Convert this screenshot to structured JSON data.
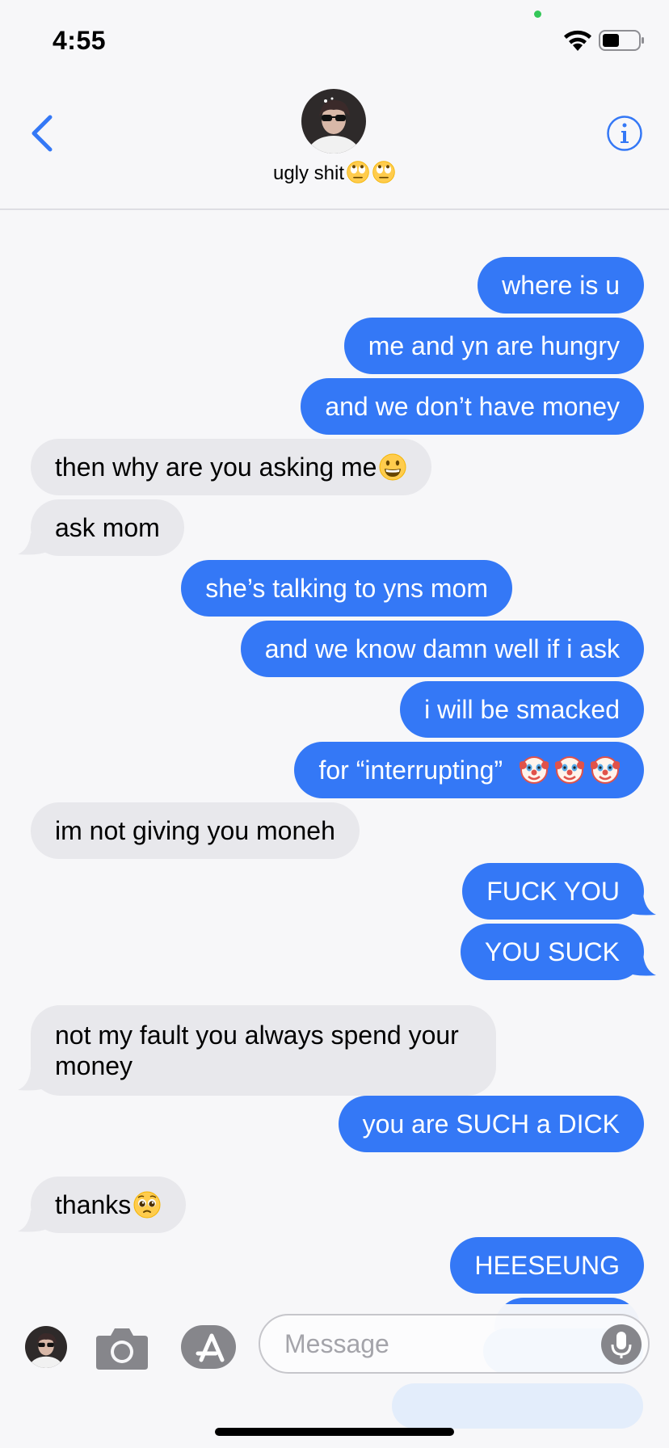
{
  "status_bar": {
    "time": "4:55",
    "icons": [
      "camera-indicator-dot",
      "wifi-icon",
      "battery-icon"
    ]
  },
  "header": {
    "contact_name": "ugly shit",
    "contact_name_emojis": [
      "eye-roll-emoji",
      "eye-roll-emoji"
    ],
    "icons": [
      "back-chevron-icon",
      "contact-avatar",
      "info-icon"
    ]
  },
  "messages": [
    {
      "side": "sent",
      "text": "where is u"
    },
    {
      "side": "sent",
      "text": "me and yn are hungry"
    },
    {
      "side": "sent",
      "text": "and we don’t have money"
    },
    {
      "side": "received",
      "text": "then why are you asking me",
      "emoji": "grinning-emoji"
    },
    {
      "side": "received",
      "text": "ask mom"
    },
    {
      "side": "sent",
      "text": "she’s talking to yns mom"
    },
    {
      "side": "sent",
      "text": "and we know damn well if i ask"
    },
    {
      "side": "sent",
      "text": "i will be smacked"
    },
    {
      "side": "sent",
      "text": "for “interrupting”",
      "emoji": "clown-emoji x3"
    },
    {
      "side": "received",
      "text": "im not giving you moneh"
    },
    {
      "side": "sent",
      "text": "FUCK YOU"
    },
    {
      "side": "sent",
      "text": "YOU SUCK"
    },
    {
      "side": "received",
      "text": "not my fault you always spend your money"
    },
    {
      "side": "sent",
      "text": "you are SUCH a DICK"
    },
    {
      "side": "received",
      "text": "thanks",
      "emoji": "pleading-emoji"
    },
    {
      "side": "sent",
      "text": "HEESEUNG"
    }
  ],
  "composer": {
    "placeholder": "Message",
    "icons": [
      "app-avatar",
      "camera-icon",
      "app-store-icon",
      "microphone-icon"
    ]
  },
  "colors": {
    "sent_bubble": "#3478f6",
    "received_bubble": "#e8e8ec",
    "background": "#f7f7f9",
    "accent": "#3478f6"
  }
}
